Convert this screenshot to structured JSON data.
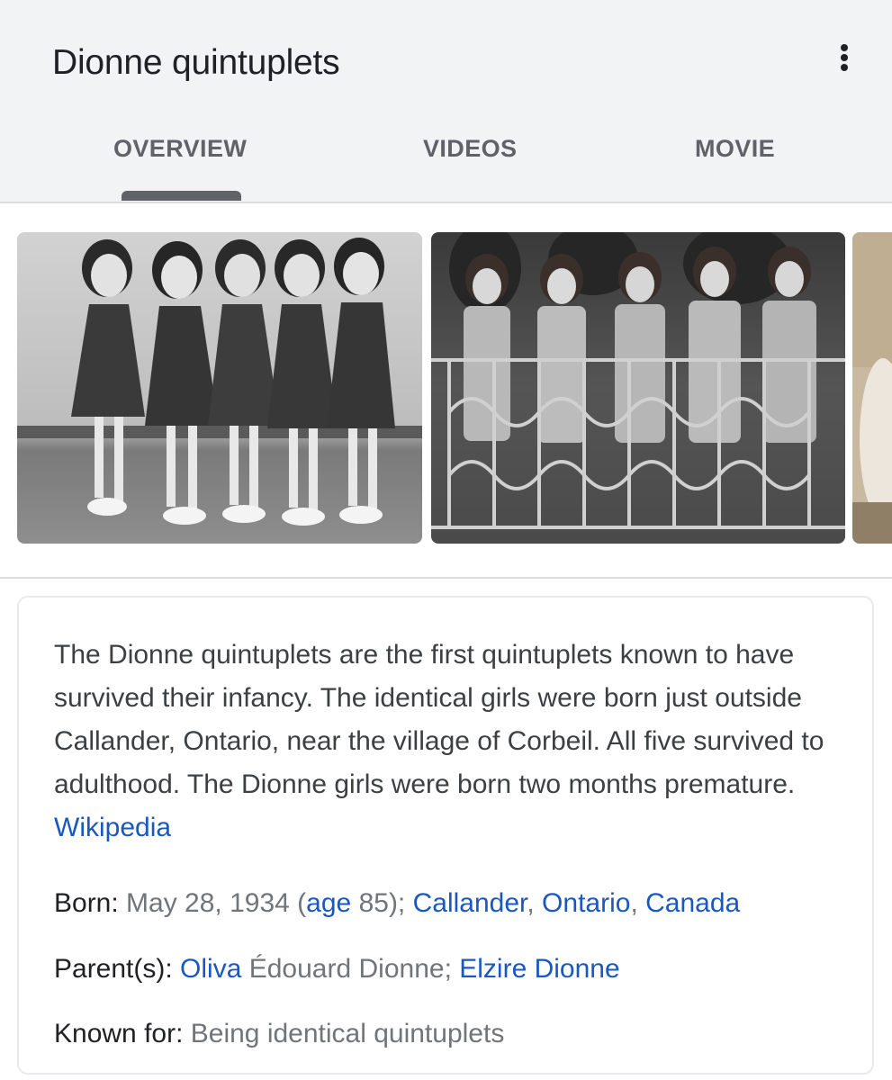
{
  "header": {
    "title": "Dionne quintuplets",
    "more_icon": "more-vert-icon"
  },
  "tabs": [
    {
      "label": "OVERVIEW",
      "selected": true
    },
    {
      "label": "VIDEOS",
      "selected": false
    },
    {
      "label": "MOVIE",
      "selected": false
    }
  ],
  "images": [
    {
      "name": "quintuplets-photo-1",
      "kind": "black-and-white photograph of five girls in dresses"
    },
    {
      "name": "quintuplets-photo-2",
      "kind": "black-and-white photograph of five girls behind a railing"
    },
    {
      "name": "quintuplets-photo-3",
      "kind": "partially visible sepia photograph"
    }
  ],
  "description": {
    "text": "The Dionne quintuplets are the first quintuplets known to have survived their infancy. The identical girls were born just outside Callander, Ontario, near the village of Corbeil. All five survived to adulthood. The Dionne girls were born two months premature. ",
    "source_link": "Wikipedia"
  },
  "facts": {
    "born": {
      "label": "Born: ",
      "date": "May 28, 1934 (",
      "age_link": "age",
      "age_rest": " 85); ",
      "place1": "Callander",
      "sep1": ", ",
      "place2": "Ontario",
      "sep2": ", ",
      "place3": "Canada"
    },
    "parents": {
      "label": "Parent(s): ",
      "parent1_link": "Oliva",
      "parent1_rest": " Édouard Dionne; ",
      "parent2_link": "Elzire Dionne"
    },
    "known_for": {
      "label": "Known for: ",
      "value": "Being identical quintuplets"
    }
  },
  "colors": {
    "header_bg": "#f1f3f4",
    "link": "#1a58c1",
    "muted": "#70757a",
    "tab_text": "#5f6368"
  }
}
